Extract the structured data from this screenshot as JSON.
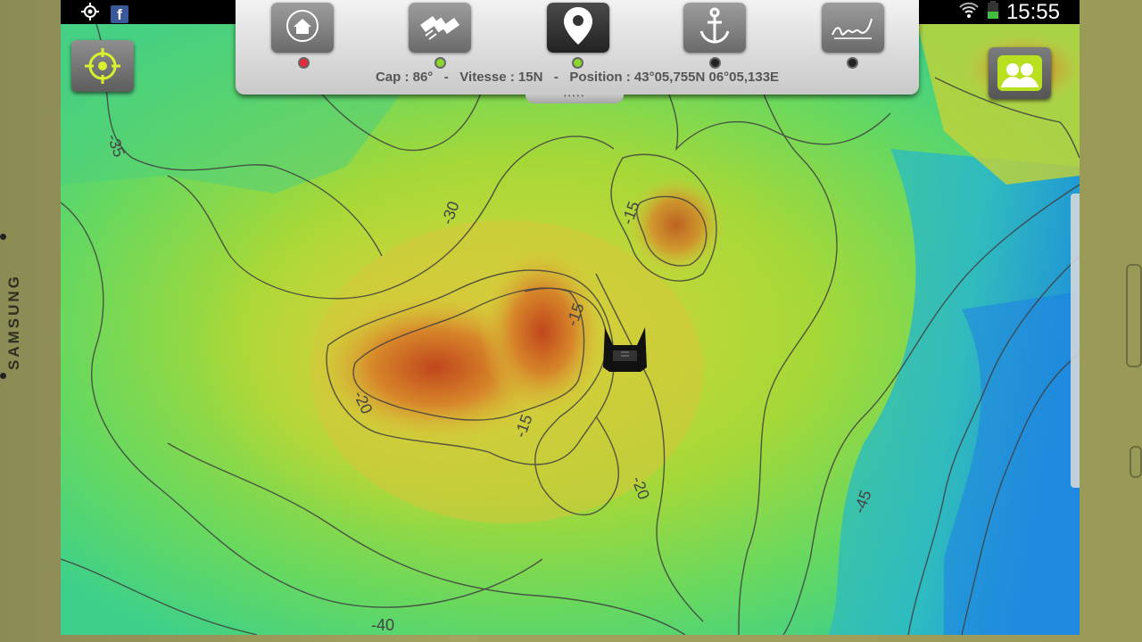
{
  "device": {
    "brand": "SAMSUNG"
  },
  "statusbar": {
    "time": "15:55",
    "icons": [
      "gps-icon",
      "facebook-icon",
      "wifi-icon",
      "battery-icon"
    ],
    "facebook_glyph": "f"
  },
  "toolbar": {
    "tools": [
      {
        "name": "home-button",
        "icon": "home-icon",
        "status": "red"
      },
      {
        "name": "satellite-button",
        "icon": "satellite-icon",
        "status": "green"
      },
      {
        "name": "position-button",
        "icon": "map-pin-icon",
        "status": "green",
        "active": true
      },
      {
        "name": "anchor-button",
        "icon": "anchor-icon",
        "status": "off"
      },
      {
        "name": "route-button",
        "icon": "signature-icon",
        "status": "off"
      }
    ],
    "info_text": "Cap : 86°   -   Vitesse : 15N   -   Position : 43°05,755N 06°05,133E",
    "handle_glyph": "•••••"
  },
  "map": {
    "depth_labels": [
      "-35",
      "-30",
      "-15",
      "-15",
      "-20",
      "-15",
      "-20",
      "-45",
      "-40"
    ]
  },
  "colors": {
    "led_red": "#e8283c",
    "led_green": "#8ad62a",
    "led_off": "#222222",
    "target_icon": "#d8f030",
    "users_button": "#b8e020"
  }
}
